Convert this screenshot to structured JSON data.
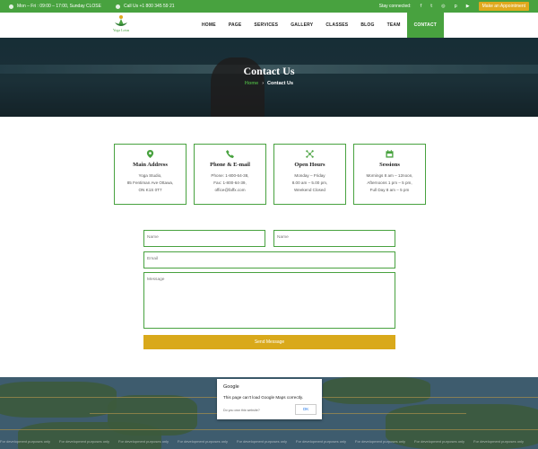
{
  "topbar": {
    "hours": "Mon – Fri : 09:00 – 17:00, Sunday CLOSE",
    "phone": "Call Us +1 800 345 59 21",
    "social_label": "Stay connected:",
    "social_icons": [
      "facebook-icon",
      "twitter-icon",
      "instagram-icon",
      "pinterest-icon",
      "youtube-icon"
    ],
    "social_glyphs": [
      "f",
      "t",
      "◎",
      "p",
      "▶"
    ],
    "appointment": "Make an Appointment",
    "colors": {
      "bar": "#48a23f",
      "appointment": "#e0a91d"
    }
  },
  "logo": {
    "text": "Yoga Lotus"
  },
  "nav": {
    "items": [
      {
        "label": "HOME"
      },
      {
        "label": "PAGE"
      },
      {
        "label": "SERVICES"
      },
      {
        "label": "GALLERY"
      },
      {
        "label": "CLASSES"
      },
      {
        "label": "BLOG"
      },
      {
        "label": "TEAM"
      },
      {
        "label": "CONTACT",
        "active": true
      }
    ]
  },
  "hero": {
    "title": "Contact Us",
    "breadcrumb": {
      "home": "Home",
      "separator": "›",
      "current": "Contact Us"
    }
  },
  "info_boxes": [
    {
      "icon": "map-pin-icon",
      "title": "Main Address",
      "lines": [
        "Yoga Studio,",
        "85 Fentiman Ave Ottawa,",
        "ON K1S 0T7"
      ]
    },
    {
      "icon": "phone-icon",
      "title": "Phone & E-mail",
      "lines": [
        "Phone: 1-800-64-38,",
        "Fax: 1-800-64-39,",
        "office@faffx.com"
      ]
    },
    {
      "icon": "network-icon",
      "title": "Open Hours",
      "lines": [
        "Monday – Friday",
        "8.00 am – 5.00 pm,",
        "Weekend Closed"
      ]
    },
    {
      "icon": "calendar-icon",
      "title": "Sessions",
      "lines": [
        "Mornings 8 am – 12noon,",
        "Afternoons 1 pm – 5 pm,",
        "Full Day 8 am – 5 pm"
      ]
    }
  ],
  "form": {
    "name1_placeholder": "Name",
    "name2_placeholder": "Name",
    "email_placeholder": "Email",
    "message_placeholder": "Message",
    "submit": "Send Message",
    "accent": "#48a23f",
    "button_color": "#d9a91b"
  },
  "map": {
    "watermark": "For development purposes only",
    "dialog": {
      "title": "Google",
      "message": "This page can't load Google Maps correctly.",
      "question": "Do you own this website?",
      "ok": "OK"
    }
  }
}
